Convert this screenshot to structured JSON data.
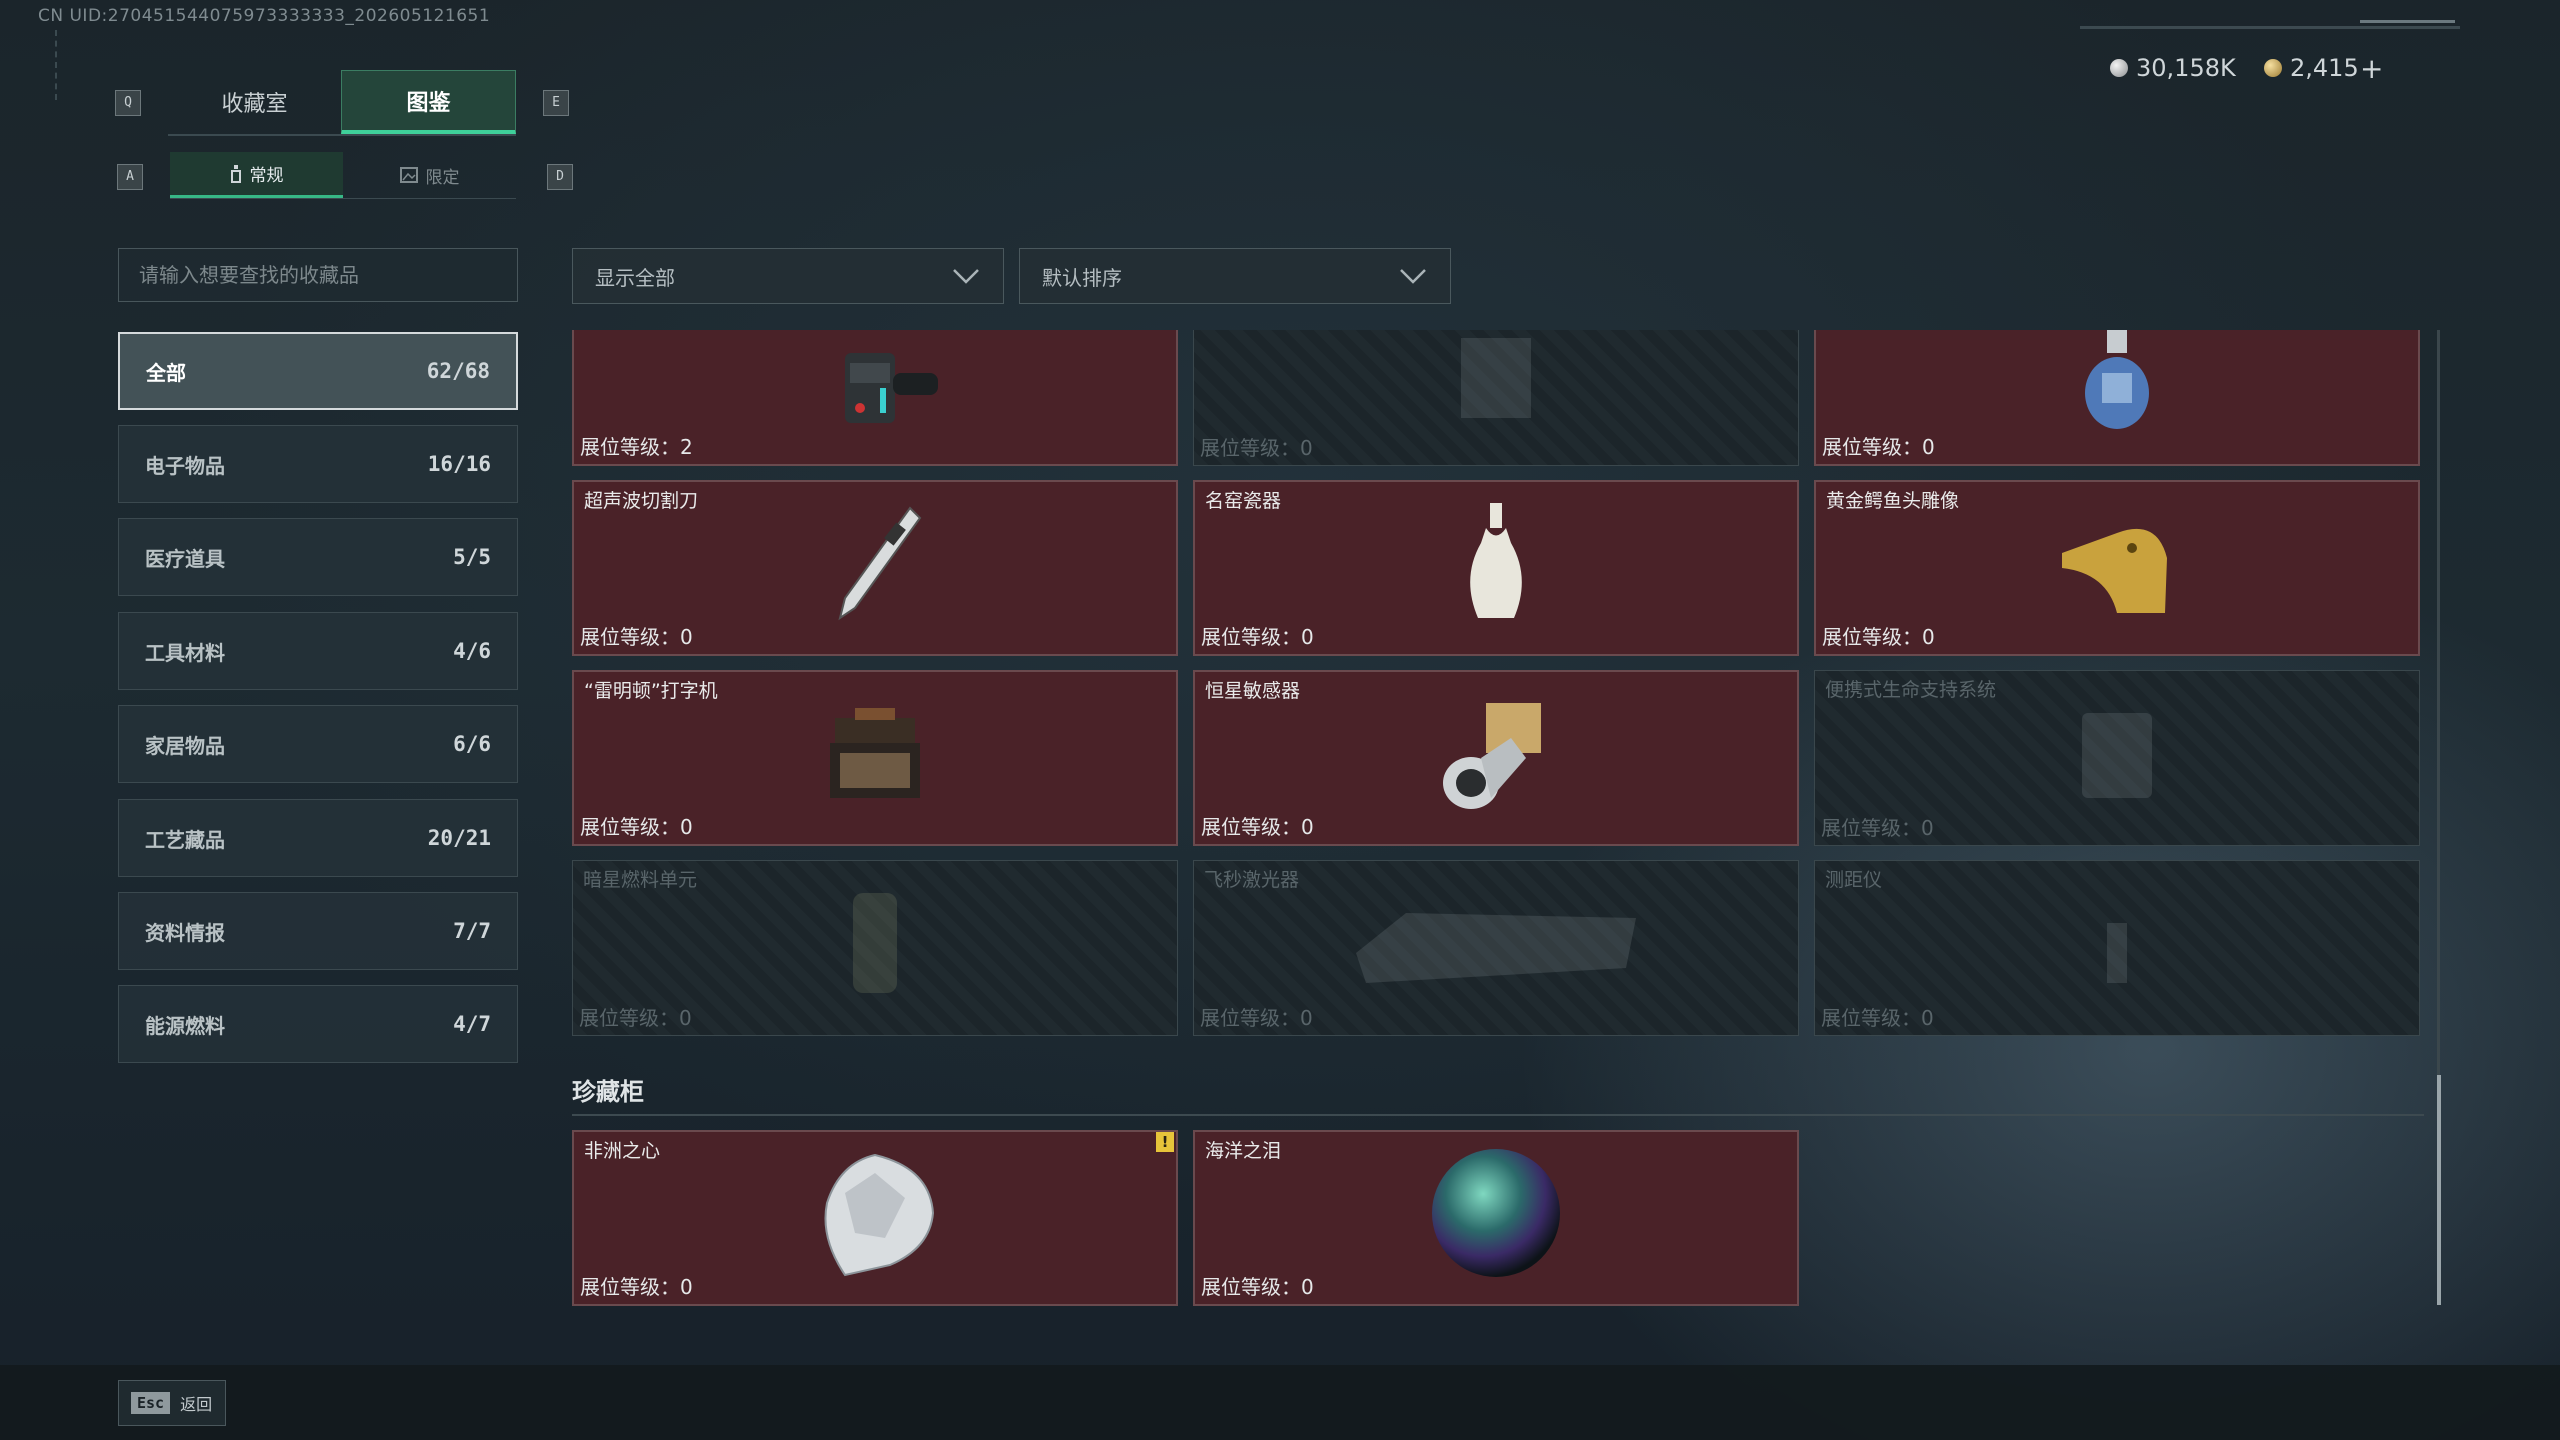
{
  "uid": "CN UID:270451544075973333333_202605121651",
  "keys": {
    "q": "Q",
    "e": "E",
    "a": "A",
    "d": "D"
  },
  "tabs": [
    {
      "label": "收藏室"
    },
    {
      "label": "图鉴"
    }
  ],
  "subtabs": [
    {
      "label": "常规"
    },
    {
      "label": "限定"
    }
  ],
  "currency": {
    "silver": "30,158K",
    "gold": "2,415",
    "plus": "+"
  },
  "search": {
    "placeholder": "请输入想要查找的收藏品"
  },
  "filters": {
    "show": "显示全部",
    "sort": "默认排序"
  },
  "categories": [
    {
      "label": "全部",
      "count": "62/68"
    },
    {
      "label": "电子物品",
      "count": "16/16"
    },
    {
      "label": "医疗道具",
      "count": "5/5"
    },
    {
      "label": "工具材料",
      "count": "4/6"
    },
    {
      "label": "家居物品",
      "count": "6/6"
    },
    {
      "label": "工艺藏品",
      "count": "20/21"
    },
    {
      "label": "资料情报",
      "count": "7/7"
    },
    {
      "label": "能源燃料",
      "count": "4/7"
    }
  ],
  "items": [
    {
      "name": "",
      "level": "展位等级：2",
      "locked": false,
      "icon": "tactical-device-icon"
    },
    {
      "name": "",
      "level": "展位等级：0",
      "locked": true,
      "icon": "locked-item-icon"
    },
    {
      "name": "",
      "level": "展位等级：0",
      "locked": false,
      "icon": "gas-canister-icon"
    },
    {
      "name": "超声波切割刀",
      "level": "展位等级：0",
      "locked": false,
      "icon": "ultrasonic-cutter-icon"
    },
    {
      "name": "名窑瓷器",
      "level": "展位等级：0",
      "locked": false,
      "icon": "porcelain-vase-icon"
    },
    {
      "name": "黄金鳄鱼头雕像",
      "level": "展位等级：0",
      "locked": false,
      "icon": "golden-crocodile-icon"
    },
    {
      "name": "“雷明顿”打字机",
      "level": "展位等级：0",
      "locked": false,
      "icon": "typewriter-icon"
    },
    {
      "name": "恒星敏感器",
      "level": "展位等级：0",
      "locked": false,
      "icon": "star-sensor-icon"
    },
    {
      "name": "便携式生命支持系统",
      "level": "展位等级：0",
      "locked": true,
      "icon": "life-support-icon"
    },
    {
      "name": "暗星燃料单元",
      "level": "展位等级：0",
      "locked": true,
      "icon": "fuel-cell-icon"
    },
    {
      "name": "飞秒激光器",
      "level": "展位等级：0",
      "locked": true,
      "icon": "laser-icon"
    },
    {
      "name": "测距仪",
      "level": "展位等级：0",
      "locked": true,
      "icon": "rangefinder-icon"
    }
  ],
  "treasure": {
    "title": "珍藏柜",
    "items": [
      {
        "name": "非洲之心",
        "level": "展位等级：0",
        "locked": false,
        "icon": "diamond-icon",
        "warning": "!"
      },
      {
        "name": "海洋之泪",
        "level": "展位等级：0",
        "locked": false,
        "icon": "pearl-icon"
      }
    ]
  },
  "footer": {
    "esc_key": "Esc",
    "esc_label": "返回"
  }
}
